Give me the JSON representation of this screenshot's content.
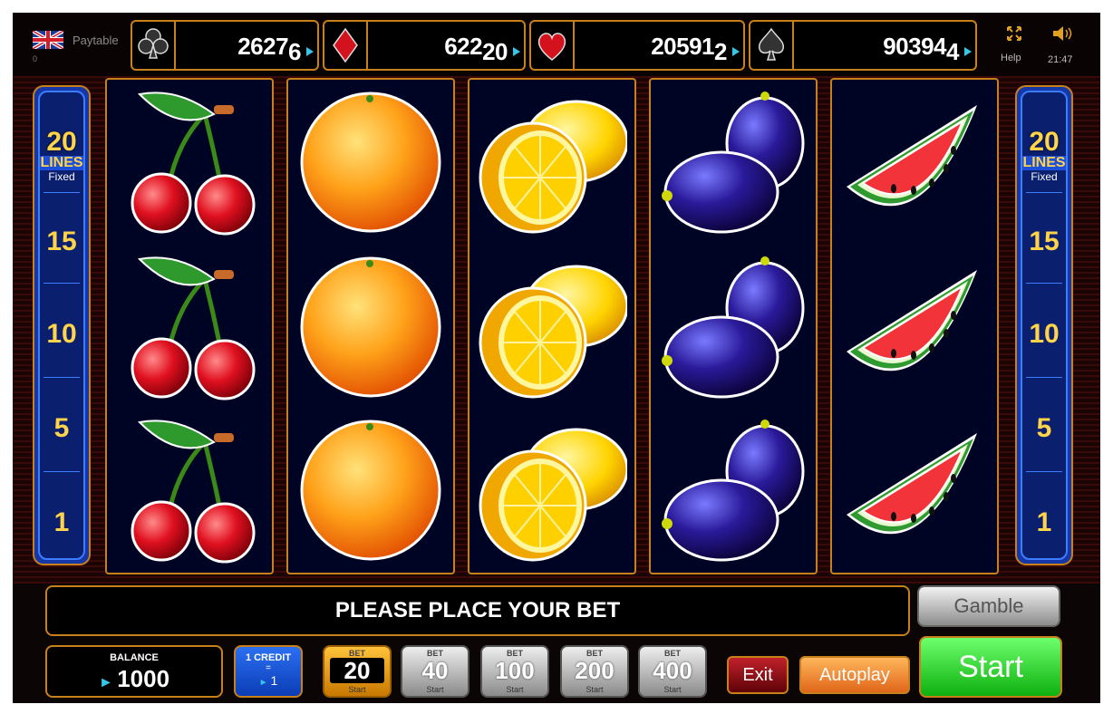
{
  "top_bar": {
    "paytable_label": "Paytable",
    "counter": "0",
    "help_label": "Help",
    "clock": "21:47",
    "icons": [
      "flag-uk-icon",
      "fullscreen-icon",
      "sound-icon"
    ]
  },
  "jackpots": [
    {
      "suit": "clubs",
      "amount": "2627",
      "sub": "6"
    },
    {
      "suit": "diamonds",
      "amount": "622",
      "sub": "20"
    },
    {
      "suit": "hearts",
      "amount": "20591",
      "sub": "2"
    },
    {
      "suit": "spades",
      "amount": "90394",
      "sub": "4"
    }
  ],
  "lines_panel": {
    "count": "20",
    "lines_label": "LINES",
    "fixed_label": "Fixed",
    "markers": [
      "15",
      "10",
      "5",
      "1"
    ]
  },
  "reels": [
    [
      "cherry",
      "cherry",
      "cherry"
    ],
    [
      "orange",
      "orange",
      "orange"
    ],
    [
      "lemon",
      "lemon",
      "lemon"
    ],
    [
      "plum",
      "plum",
      "plum"
    ],
    [
      "watermelon",
      "watermelon",
      "watermelon"
    ]
  ],
  "message": "PLEASE PLACE YOUR BET",
  "buttons": {
    "gamble": "Gamble",
    "exit": "Exit",
    "autoplay": "Autoplay",
    "start": "Start"
  },
  "balance": {
    "label": "BALANCE",
    "value": "1000"
  },
  "credit": {
    "label": "1 CREDIT",
    "eq": "=",
    "value": "1"
  },
  "bets": [
    {
      "label": "BET",
      "value": "20",
      "start": "Start",
      "active": true
    },
    {
      "label": "BET",
      "value": "40",
      "start": "Start",
      "active": false
    },
    {
      "label": "BET",
      "value": "100",
      "start": "Start",
      "active": false
    },
    {
      "label": "BET",
      "value": "200",
      "start": "Start",
      "active": false
    },
    {
      "label": "BET",
      "value": "400",
      "start": "Start",
      "active": false
    }
  ]
}
